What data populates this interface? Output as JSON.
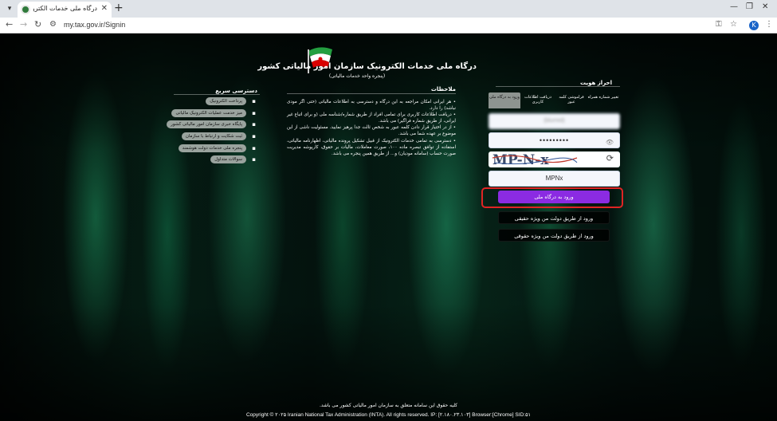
{
  "browser": {
    "tab_title": "درگاه ملی خدمات الکترونیک ساز...",
    "url": "my.tax.gov.ir/Signin",
    "profile_initial": "K"
  },
  "site": {
    "title": "درگاه ملی خدمات الکترونیک سازمان امور مالیاتی کشور",
    "subtitle": "(پنجره واحد خدمات مالیاتی)"
  },
  "quick_access": {
    "heading": "دسترسی سریع",
    "items": [
      "پرداخت الکترونیک",
      "میز خدمت عملیات الکترونیک مالیاتی",
      "پایگاه خبری سازمان امور مالیاتی کشور",
      "ثبت شکایت و ارتباط با سازمان",
      "پنجره ملی خدمات دولت هوشمند",
      "سوالات متداول"
    ]
  },
  "notes": {
    "heading": "ملاحظات",
    "items": [
      "• هر ایرانی امکان مراجعه به این درگاه و دسترسی به اطلاعات مالیاتی (حتی اگر مودی نباشد) را دارد.",
      "• دریافت اطلاعات کاربری برای تمامی افراد از طریق شماره/شناسه ملی (و برای اتباع غیر ایرانی، از طریق شماره فراگیر) می باشد.",
      "• از در اختیار قرار دادن کلمه عبور به شخص ثالث جدا پرهیز نمایید. مسئولیت ناشی از این موضوع بر عهده شما می باشد.",
      "• دسترسی به تمامی خدمات الکترونیک از قبیل تشکیل پرونده مالیاتی، اظهارنامه مالیاتی، استفاده از توافق تبصره ماده ۱۰۰، صورت معاملات، مالیات بر حقوق، کارپوشه مدیریت صورت حساب (سامانه مودیان) و... از طریق همین پنجره می باشد."
    ]
  },
  "login": {
    "heading": "احراز هویت",
    "tabs": [
      "ورود به درگاه ملی",
      "دریافت اطلاعات کاربری",
      "فراموشی کلمه عبور",
      "تغییر شماره همراه"
    ],
    "username": "(blurred)",
    "password": "•••••••••",
    "captcha_image_text": "MP-N-x",
    "captcha_value": "MPNx",
    "buttons": {
      "login": "ورود به درگاه ملی",
      "legal_person": "ورود از طریق دولت من ویژه حقیقی",
      "natural_person": "ورود از طریق دولت من ویژه حقوقی"
    }
  },
  "footer": {
    "rights_fa": "کلیه حقوق این سامانه متعلق به سازمان امور مالیاتی کشور می باشد.",
    "copyright_en": "Copyright © ۲۰۲۵ Iranian National Tax Administration (INTA). All rights reserved. IP: [۲.۱۸۰.۲۳.۱۰۳] Browser:[Chrome] SID:۵۱"
  },
  "colors": {
    "primary_button": "#8b2be2",
    "highlight": "#e02424"
  }
}
